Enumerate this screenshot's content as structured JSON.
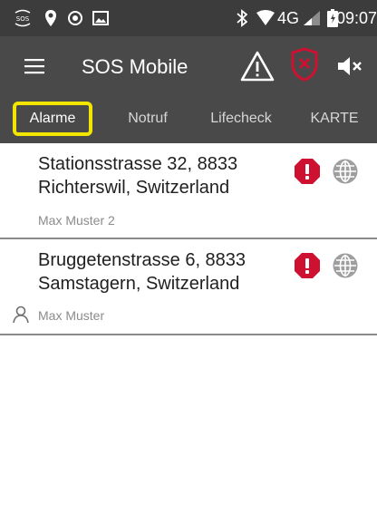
{
  "status_bar": {
    "network": "4G",
    "time": "09:07",
    "icons": [
      "sos-icon",
      "location-pin-icon",
      "record-icon",
      "image-icon",
      "bluetooth-icon",
      "wifi-icon",
      "signal-icon",
      "battery-icon"
    ]
  },
  "toolbar": {
    "title": "SOS Mobile",
    "icons": [
      "menu-icon",
      "warning-icon",
      "shield-x-icon",
      "mute-icon"
    ]
  },
  "tabs": [
    {
      "label": "Alarme",
      "active": true
    },
    {
      "label": "Notruf",
      "active": false
    },
    {
      "label": "Lifecheck",
      "active": false
    },
    {
      "label": "KARTE",
      "active": false
    }
  ],
  "alarms": [
    {
      "address": "Stationsstrasse 32, 8833 Richterswil, Switzerland",
      "user": "Max Muster 2",
      "user_icon": false,
      "status_icons": [
        "alert-icon",
        "globe-icon"
      ]
    },
    {
      "address": "Bruggetenstrasse 6, 8833 Samstagern, Switzerland",
      "user": "Max Muster",
      "user_icon": true,
      "status_icons": [
        "alert-icon",
        "globe-icon"
      ]
    }
  ],
  "colors": {
    "statusbar": "#3c3c3c",
    "toolbar": "#494949",
    "alert_red": "#cf1131",
    "highlight": "#f2e600",
    "globe_gray": "#9e9e9e"
  }
}
